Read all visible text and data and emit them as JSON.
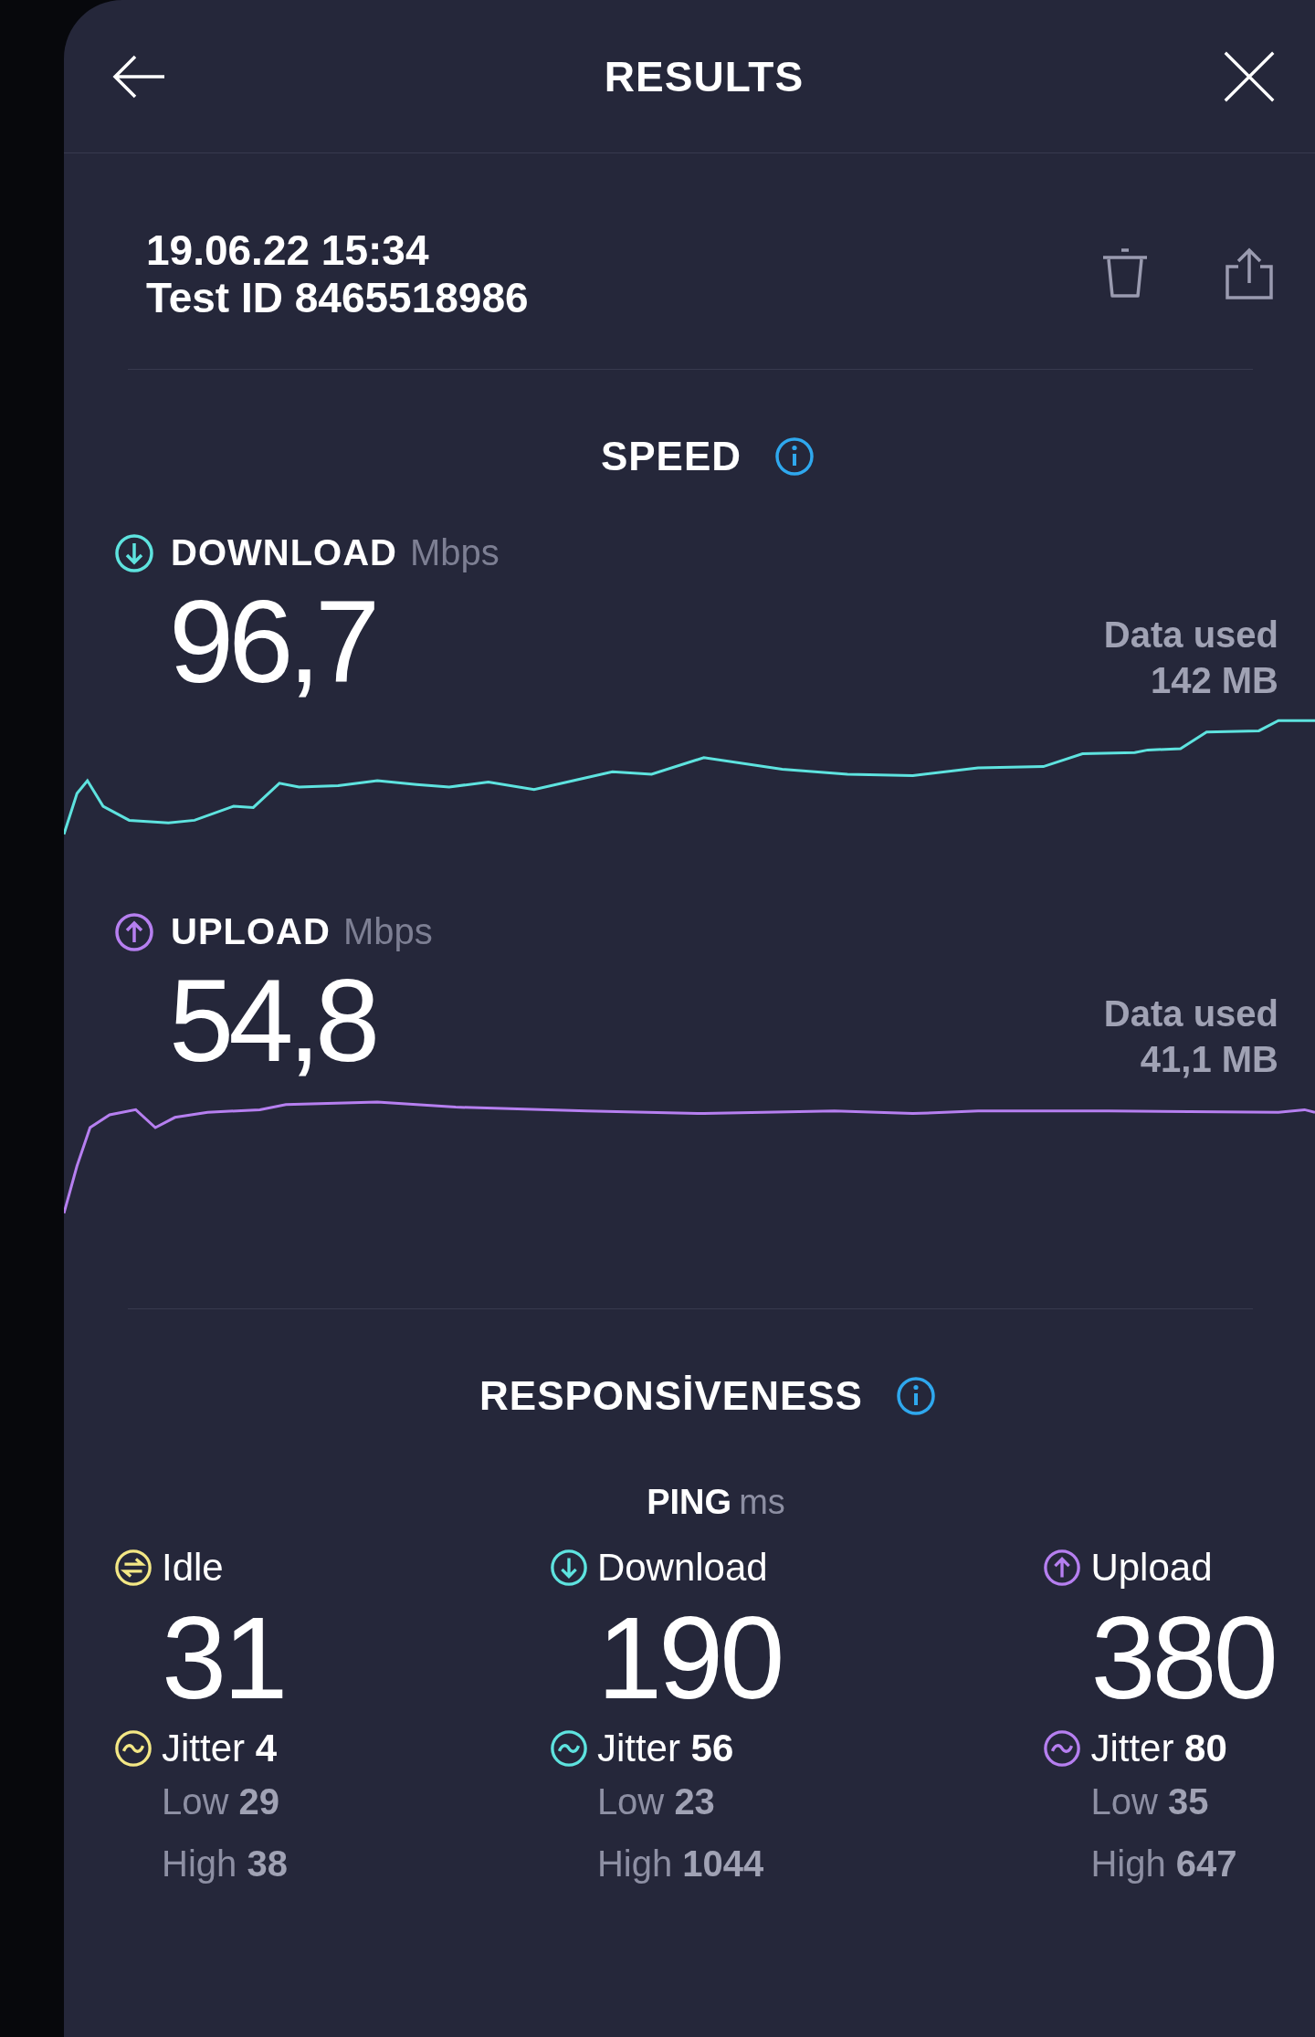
{
  "header": {
    "title": "RESULTS"
  },
  "test": {
    "date": "19.06.22 15:34",
    "test_id": "Test ID 8465518986"
  },
  "speed": {
    "title": "SPEED",
    "metrics": [
      {
        "kind": "download",
        "label": "DOWNLOAD",
        "unit": "Mbps",
        "value": "96,7",
        "data_used_label": "Data used",
        "data_used": "142 MB",
        "color": "#5ee3df"
      },
      {
        "kind": "upload",
        "label": "UPLOAD",
        "unit": "Mbps",
        "value": "54,8",
        "data_used_label": "Data used",
        "data_used": "41,1 MB",
        "color": "#b67ff0"
      }
    ]
  },
  "responsiveness": {
    "title": "RESPONSİVENESS",
    "ping_label": "PING",
    "ping_unit": "ms",
    "columns": [
      {
        "kind": "idle",
        "label": "Idle",
        "value": "31",
        "jitter_label": "Jitter",
        "jitter": "4",
        "low_label": "Low",
        "low": "29",
        "high_label": "High",
        "high": "38",
        "color": "#f3e785"
      },
      {
        "kind": "download",
        "label": "Download",
        "value": "190",
        "jitter_label": "Jitter",
        "jitter": "56",
        "low_label": "Low",
        "low": "23",
        "high_label": "High",
        "high": "1044",
        "color": "#5ee3df"
      },
      {
        "kind": "upload",
        "label": "Upload",
        "value": "380",
        "jitter_label": "Jitter",
        "jitter": "80",
        "low_label": "Low",
        "low": "35",
        "high_label": "High",
        "high": "647",
        "color": "#b67ff0"
      }
    ]
  }
}
